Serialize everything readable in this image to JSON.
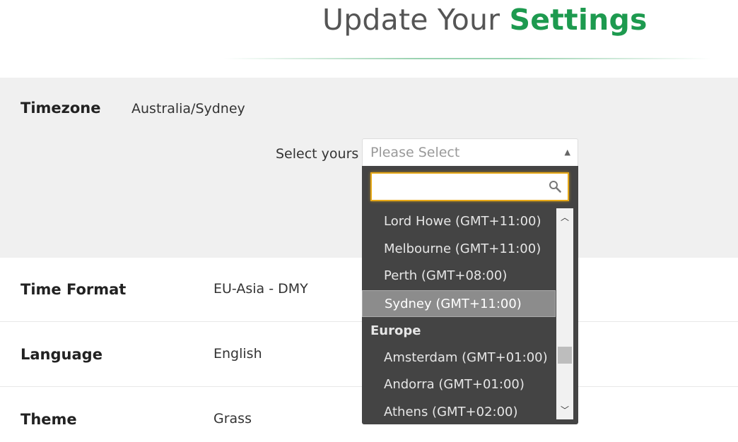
{
  "header": {
    "title_plain": "Update Your ",
    "title_accent": "Settings"
  },
  "timezone": {
    "label": "Timezone",
    "current_value": "Australia/Sydney",
    "select_label": "Select yours",
    "placeholder": "Please Select",
    "search_value": "",
    "options_visible": [
      {
        "kind": "option",
        "label": "Lord Howe (GMT+11:00)"
      },
      {
        "kind": "option",
        "label": "Melbourne (GMT+11:00)"
      },
      {
        "kind": "option",
        "label": "Perth (GMT+08:00)"
      },
      {
        "kind": "option",
        "label": "Sydney (GMT+11:00)",
        "selected": true
      },
      {
        "kind": "group",
        "label": "Europe"
      },
      {
        "kind": "option",
        "label": "Amsterdam (GMT+01:00)"
      },
      {
        "kind": "option",
        "label": "Andorra (GMT+01:00)"
      },
      {
        "kind": "option",
        "label": "Athens (GMT+02:00)"
      }
    ]
  },
  "time_format": {
    "label": "Time Format",
    "value": "EU-Asia - DMY"
  },
  "language": {
    "label": "Language",
    "value": "English"
  },
  "theme": {
    "label": "Theme",
    "value": "Grass"
  },
  "icons": {
    "search": "search-icon",
    "arrow": "caret-up-icon",
    "scroll_up": "chevron-up-icon",
    "scroll_down": "chevron-down-icon"
  },
  "colors": {
    "accent": "#1d9a4f",
    "dropdown_bg": "#444444",
    "focus_border": "#e6a817",
    "section_bg": "#f0f0f0"
  }
}
